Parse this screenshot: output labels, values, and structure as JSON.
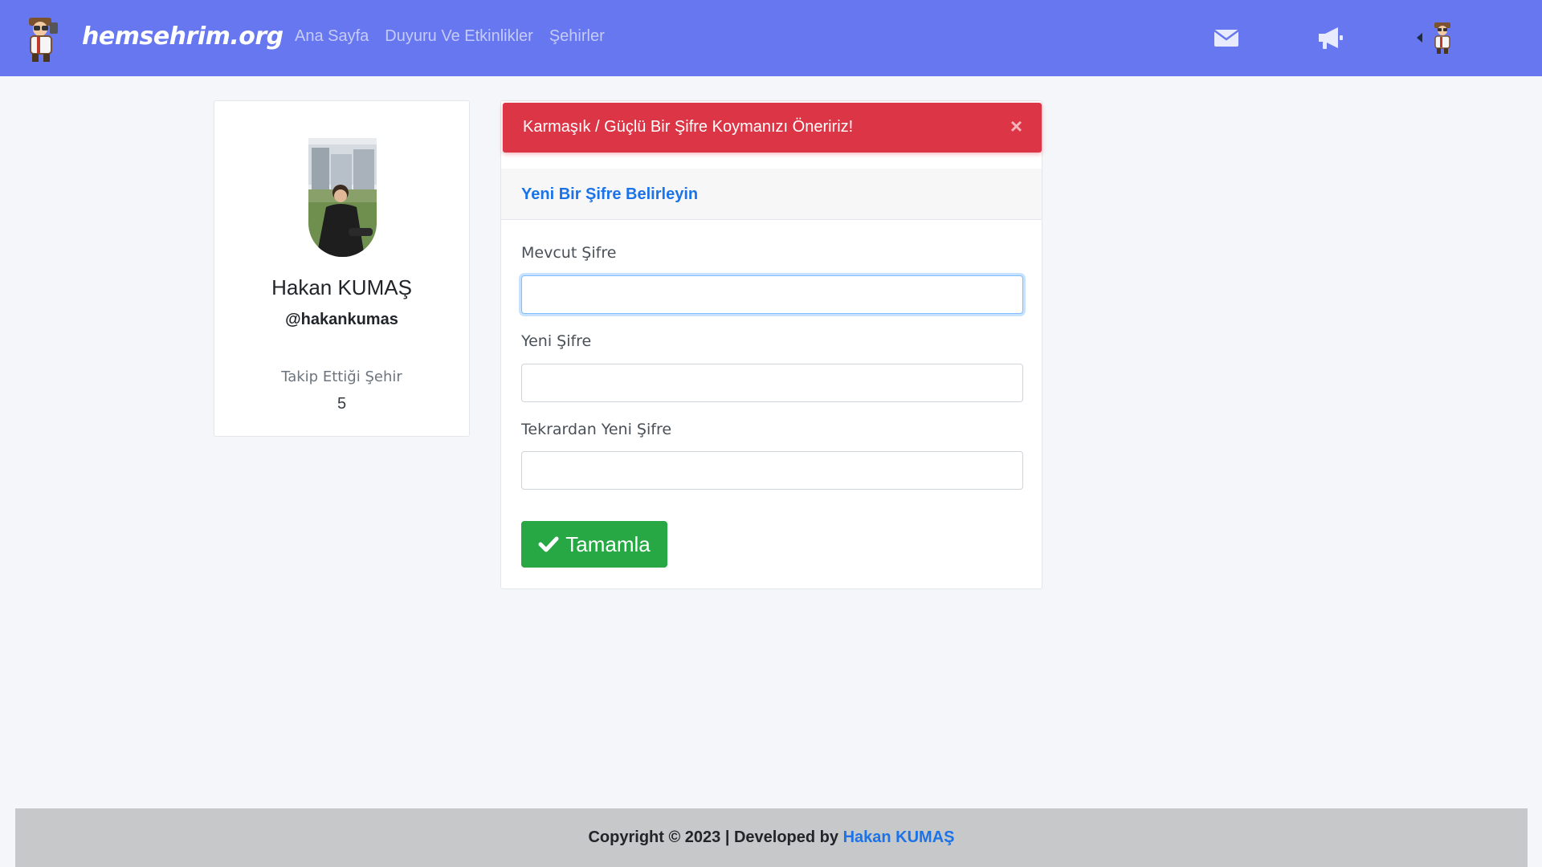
{
  "brand": {
    "name": "hemsehrim.org",
    "logo_icon": "explorer-mascot-logo"
  },
  "nav": {
    "links": [
      {
        "label": "Ana Sayfa"
      },
      {
        "label": "Duyuru Ve Etkinlikler"
      },
      {
        "label": "Şehirler"
      }
    ],
    "icons": {
      "mail": "envelope-icon",
      "announcement": "megaphone-icon",
      "user_menu": "user-avatar"
    }
  },
  "profile": {
    "name": "Hakan KUMAŞ",
    "handle": "@hakankumas",
    "follow_label": "Takip Ettiği Şehir",
    "follow_count": "5"
  },
  "alert": {
    "message": "Karmaşık / Güçlü Bir Şifre Koymanızı Öneririz!",
    "close_symbol": "×"
  },
  "form": {
    "title": "Yeni Bir Şifre Belirleyin",
    "fields": [
      {
        "label": "Mevcut Şifre",
        "value": ""
      },
      {
        "label": "Yeni Şifre",
        "value": ""
      },
      {
        "label": "Tekrardan Yeni Şifre",
        "value": ""
      }
    ],
    "submit_label": "Tamamla"
  },
  "footer": {
    "text": "Copyright © 2023 | Developed by",
    "author": "Hakan KUMAŞ"
  },
  "colors": {
    "navbar": "#6777ef",
    "alert": "#dc3545",
    "submit": "#28a745",
    "link": "#1a73e8",
    "footer": "#c6c8ca"
  }
}
